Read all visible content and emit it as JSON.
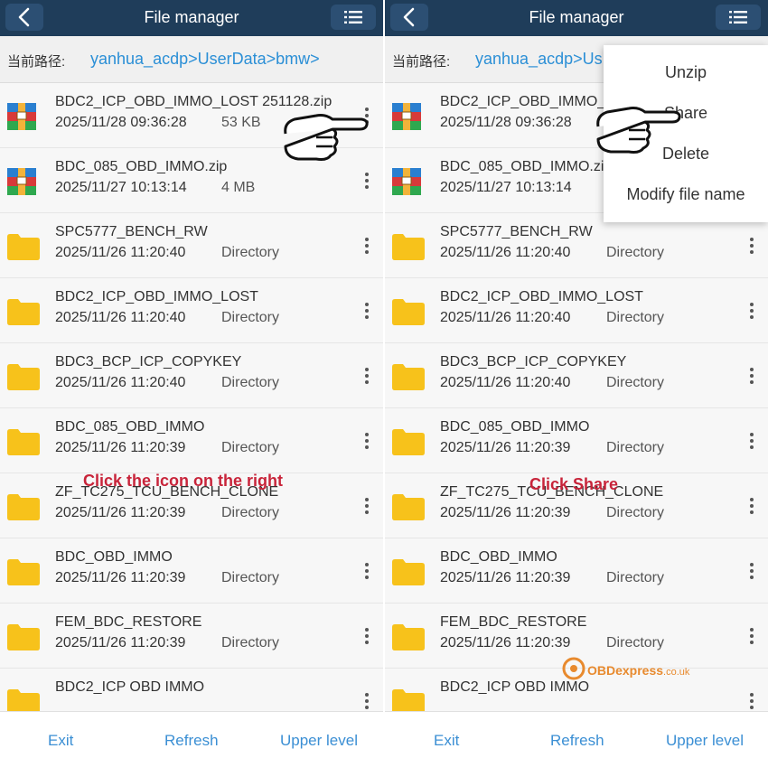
{
  "screens": [
    {
      "header": {
        "title": "File manager"
      },
      "path": {
        "label": "当前路径:",
        "value": "yanhua_acdp>UserData>bmw>"
      },
      "rows": [
        {
          "name": "BDC2_ICP_OBD_IMMO_LOST 251128.zip",
          "date": "2025/11/28 09:36:28",
          "meta": "53 KB",
          "icon": "zip-archive-icon"
        },
        {
          "name": "BDC_085_OBD_IMMO.zip",
          "date": "2025/11/27 10:13:14",
          "meta": "4 MB",
          "icon": "zip-archive-icon"
        },
        {
          "name": "SPC5777_BENCH_RW",
          "date": "2025/11/26 11:20:40",
          "meta": "Directory",
          "icon": "folder-icon"
        },
        {
          "name": "BDC2_ICP_OBD_IMMO_LOST",
          "date": "2025/11/26 11:20:40",
          "meta": "Directory",
          "icon": "folder-icon"
        },
        {
          "name": "BDC3_BCP_ICP_COPYKEY",
          "date": "2025/11/26 11:20:40",
          "meta": "Directory",
          "icon": "folder-icon"
        },
        {
          "name": "BDC_085_OBD_IMMO",
          "date": "2025/11/26 11:20:39",
          "meta": "Directory",
          "icon": "folder-icon"
        },
        {
          "name": "ZF_TC275_TCU_BENCH_CLONE",
          "date": "2025/11/26 11:20:39",
          "meta": "Directory",
          "icon": "folder-icon"
        },
        {
          "name": "BDC_OBD_IMMO",
          "date": "2025/11/26 11:20:39",
          "meta": "Directory",
          "icon": "folder-icon"
        },
        {
          "name": "FEM_BDC_RESTORE",
          "date": "2025/11/26 11:20:39",
          "meta": "Directory",
          "icon": "folder-icon"
        },
        {
          "name": "BDC2_ICP OBD IMMO",
          "date": "",
          "meta": "",
          "icon": "folder-icon"
        }
      ],
      "bottom": {
        "exit": "Exit",
        "refresh": "Refresh",
        "upper": "Upper level"
      },
      "annotation": "Click the icon on the right"
    },
    {
      "header": {
        "title": "File manager"
      },
      "path": {
        "label": "当前路径:",
        "value": "yanhua_acdp>Us"
      },
      "rows": [
        {
          "name": "BDC2_ICP_OBD_IMMO_L",
          "date": "2025/11/28 09:36:28",
          "meta": "",
          "icon": "zip-archive-icon"
        },
        {
          "name": "BDC_085_OBD_IMMO.zi",
          "date": "2025/11/27 10:13:14",
          "meta": "",
          "icon": "zip-archive-icon"
        },
        {
          "name": "SPC5777_BENCH_RW",
          "date": "2025/11/26 11:20:40",
          "meta": "Directory",
          "icon": "folder-icon"
        },
        {
          "name": "BDC2_ICP_OBD_IMMO_LOST",
          "date": "2025/11/26 11:20:40",
          "meta": "Directory",
          "icon": "folder-icon"
        },
        {
          "name": "BDC3_BCP_ICP_COPYKEY",
          "date": "2025/11/26 11:20:40",
          "meta": "Directory",
          "icon": "folder-icon"
        },
        {
          "name": "BDC_085_OBD_IMMO",
          "date": "2025/11/26 11:20:39",
          "meta": "Directory",
          "icon": "folder-icon"
        },
        {
          "name": "ZF_TC275_TCU_BENCH_CLONE",
          "date": "2025/11/26 11:20:39",
          "meta": "Directory",
          "icon": "folder-icon"
        },
        {
          "name": "BDC_OBD_IMMO",
          "date": "2025/11/26 11:20:39",
          "meta": "Directory",
          "icon": "folder-icon"
        },
        {
          "name": "FEM_BDC_RESTORE",
          "date": "2025/11/26 11:20:39",
          "meta": "Directory",
          "icon": "folder-icon"
        },
        {
          "name": "BDC2_ICP OBD IMMO",
          "date": "",
          "meta": "",
          "icon": "folder-icon"
        }
      ],
      "bottom": {
        "exit": "Exit",
        "refresh": "Refresh",
        "upper": "Upper level"
      },
      "annotation": "Click Share",
      "popup": {
        "items": [
          "Unzip",
          "Share",
          "Delete",
          "Modify file name"
        ]
      }
    }
  ],
  "watermark": {
    "brand": "OBDexpress",
    "domain": ".co.uk"
  },
  "colors": {
    "header_bg": "#1f3d5a",
    "path_link": "#2b8fd6",
    "button_text": "#3b8fd4",
    "annotation": "#c8243a",
    "folder": "#f7c21b"
  }
}
